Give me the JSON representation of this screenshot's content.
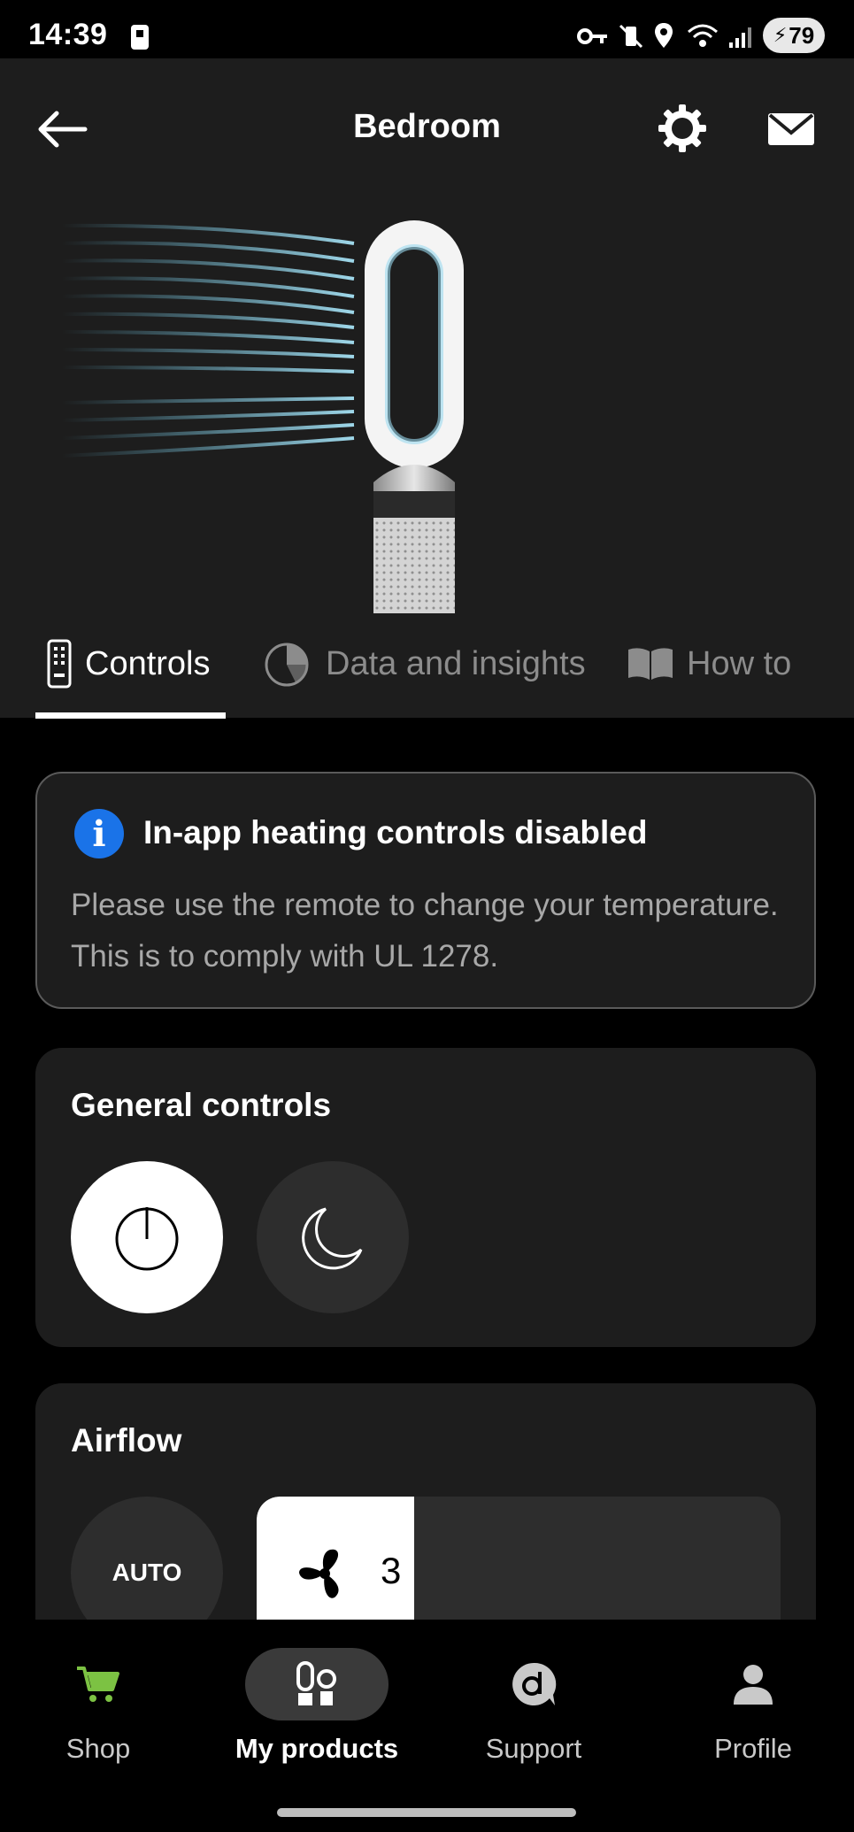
{
  "status_bar": {
    "time": "14:39",
    "battery": "79"
  },
  "header": {
    "title": "Bedroom"
  },
  "tabs": [
    {
      "label": "Controls"
    },
    {
      "label": "Data and insights"
    },
    {
      "label": "How to"
    }
  ],
  "notice": {
    "title": "In-app heating controls disabled",
    "body": "Please use the remote to change your temperature. This is to comply with UL 1278."
  },
  "general_controls": {
    "title": "General controls"
  },
  "airflow": {
    "title": "Airflow",
    "auto_label": "AUTO",
    "speed": "3"
  },
  "bottom_nav": [
    {
      "label": "Shop"
    },
    {
      "label": "My products"
    },
    {
      "label": "Support"
    },
    {
      "label": "Profile"
    }
  ],
  "colors": {
    "accent_green": "#7cc243",
    "info_blue": "#1a73e8",
    "card_bg": "#1d1d1d"
  }
}
